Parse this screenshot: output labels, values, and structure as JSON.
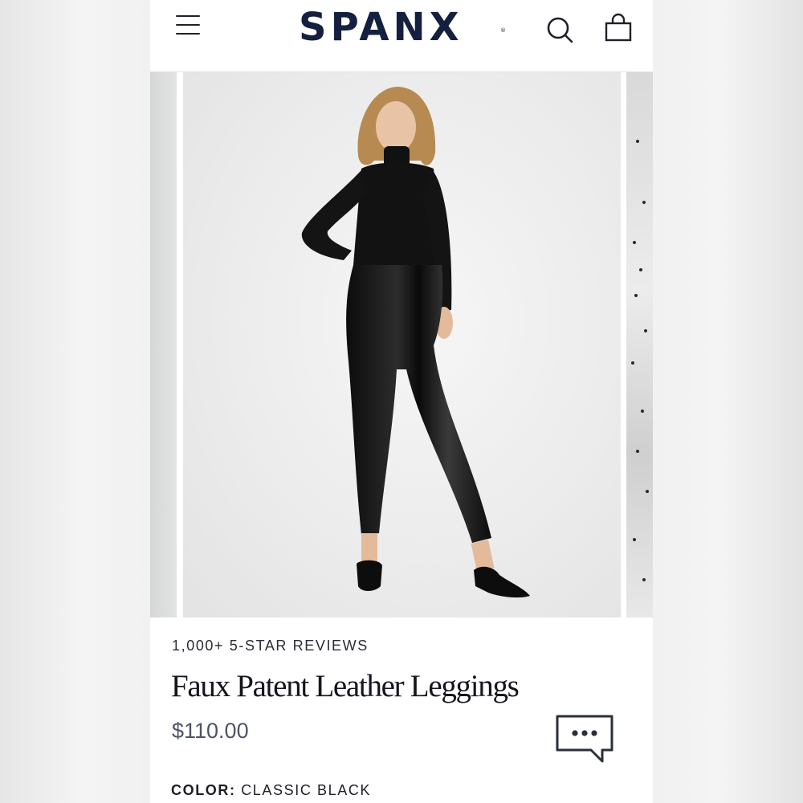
{
  "header": {
    "brand": "SPANX",
    "brand_mark": "®",
    "icons": [
      "menu-icon",
      "search-icon",
      "shopping-bag-icon"
    ]
  },
  "product": {
    "reviews_text": "1,000+ 5-STAR REVIEWS",
    "title": "Faux Patent Leather Leggings",
    "price": "$110.00",
    "color_label": "COLOR:",
    "color_value": "CLASSIC BLACK"
  },
  "chat": {
    "icon": "chat-bubble-icon"
  },
  "colors": {
    "brand_navy": "#14203f",
    "text_dark": "#14161c",
    "price_gray": "#4e5366",
    "photo_bg": "#ececec"
  }
}
